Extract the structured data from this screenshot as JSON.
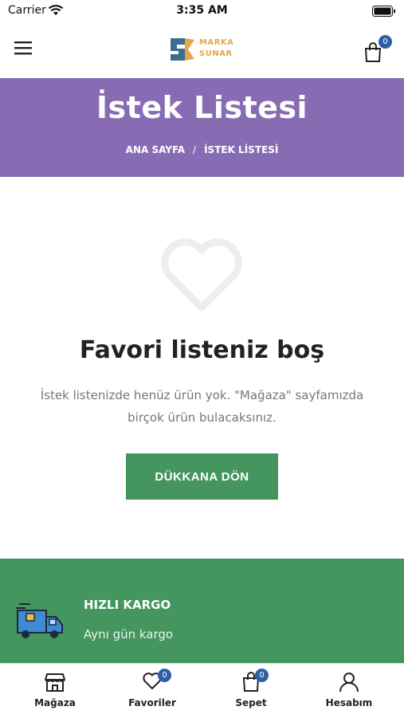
{
  "status_bar": {
    "carrier": "Carrier",
    "time": "3:35 AM"
  },
  "header": {
    "logo_line1": "MARKA",
    "logo_line2": "SUNAR",
    "cart_count": "0"
  },
  "banner": {
    "title": "İstek Listesi",
    "crumb_home": "ANA SAYFA",
    "crumb_sep": "/",
    "crumb_current": "İSTEK LİSTESİ"
  },
  "empty": {
    "title": "Favori listeniz boş",
    "description": "İstek listenizde henüz ürün yok. \"Mağaza\" sayfamızda birçok ürün bulacaksınız.",
    "button": "DÜKKANA DÖN"
  },
  "feature": {
    "title": "HIZLI KARGO",
    "subtitle": "Aynı gün kargo"
  },
  "tabbar": {
    "items": [
      {
        "label": "Mağaza",
        "icon": "store-icon"
      },
      {
        "label": "Favoriler",
        "icon": "heart-icon",
        "badge": "0"
      },
      {
        "label": "Sepet",
        "icon": "bag-icon",
        "badge": "0"
      },
      {
        "label": "Hesabım",
        "icon": "user-icon"
      }
    ]
  },
  "colors": {
    "banner": "#876cb4",
    "accent_green": "#45955f",
    "badge": "#2f5ea8"
  }
}
